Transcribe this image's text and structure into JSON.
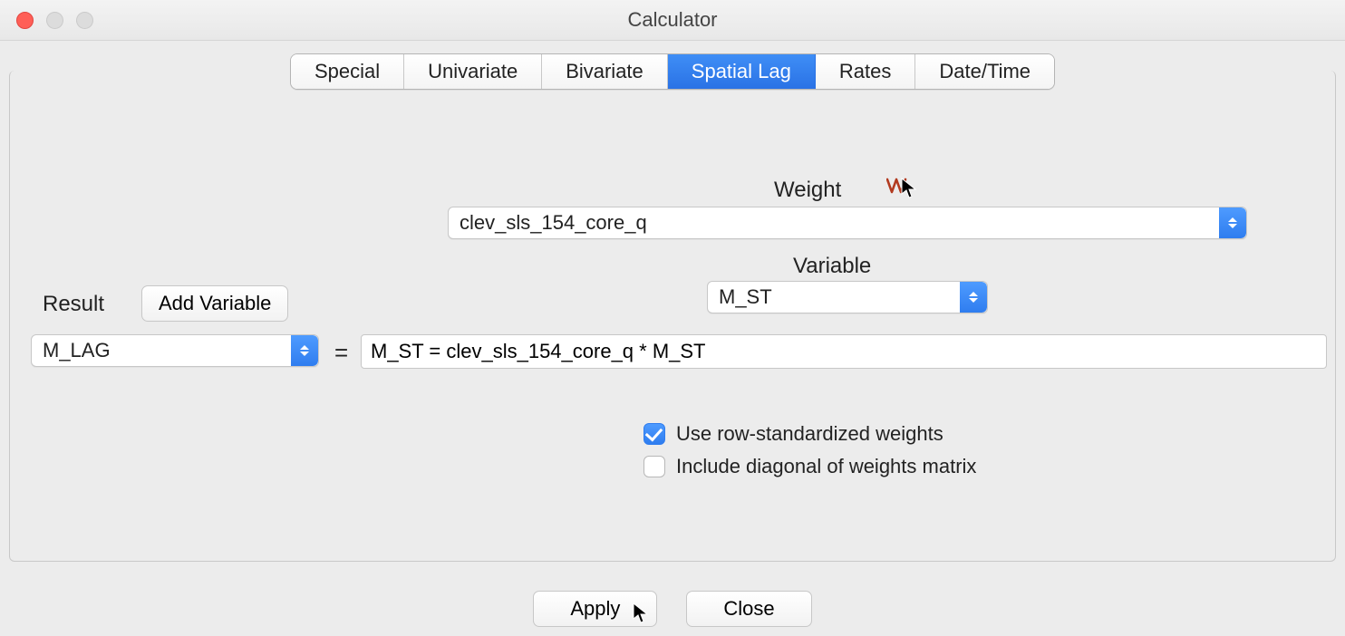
{
  "window": {
    "title": "Calculator"
  },
  "tabs": {
    "items": [
      "Special",
      "Univariate",
      "Bivariate",
      "Spatial Lag",
      "Rates",
      "Date/Time"
    ],
    "active": "Spatial Lag"
  },
  "weight": {
    "label": "Weight",
    "value": "clev_sls_154_core_q"
  },
  "variable": {
    "label": "Variable",
    "value": "M_ST"
  },
  "result": {
    "label": "Result",
    "add_variable_label": "Add Variable",
    "value": "M_LAG"
  },
  "equals": "=",
  "expression": {
    "value": "M_ST = clev_sls_154_core_q * M_ST"
  },
  "options": {
    "row_std": {
      "label": "Use row-standardized weights",
      "checked": true
    },
    "include_diag": {
      "label": "Include diagonal of weights matrix",
      "checked": false
    }
  },
  "buttons": {
    "apply": "Apply",
    "close": "Close"
  }
}
